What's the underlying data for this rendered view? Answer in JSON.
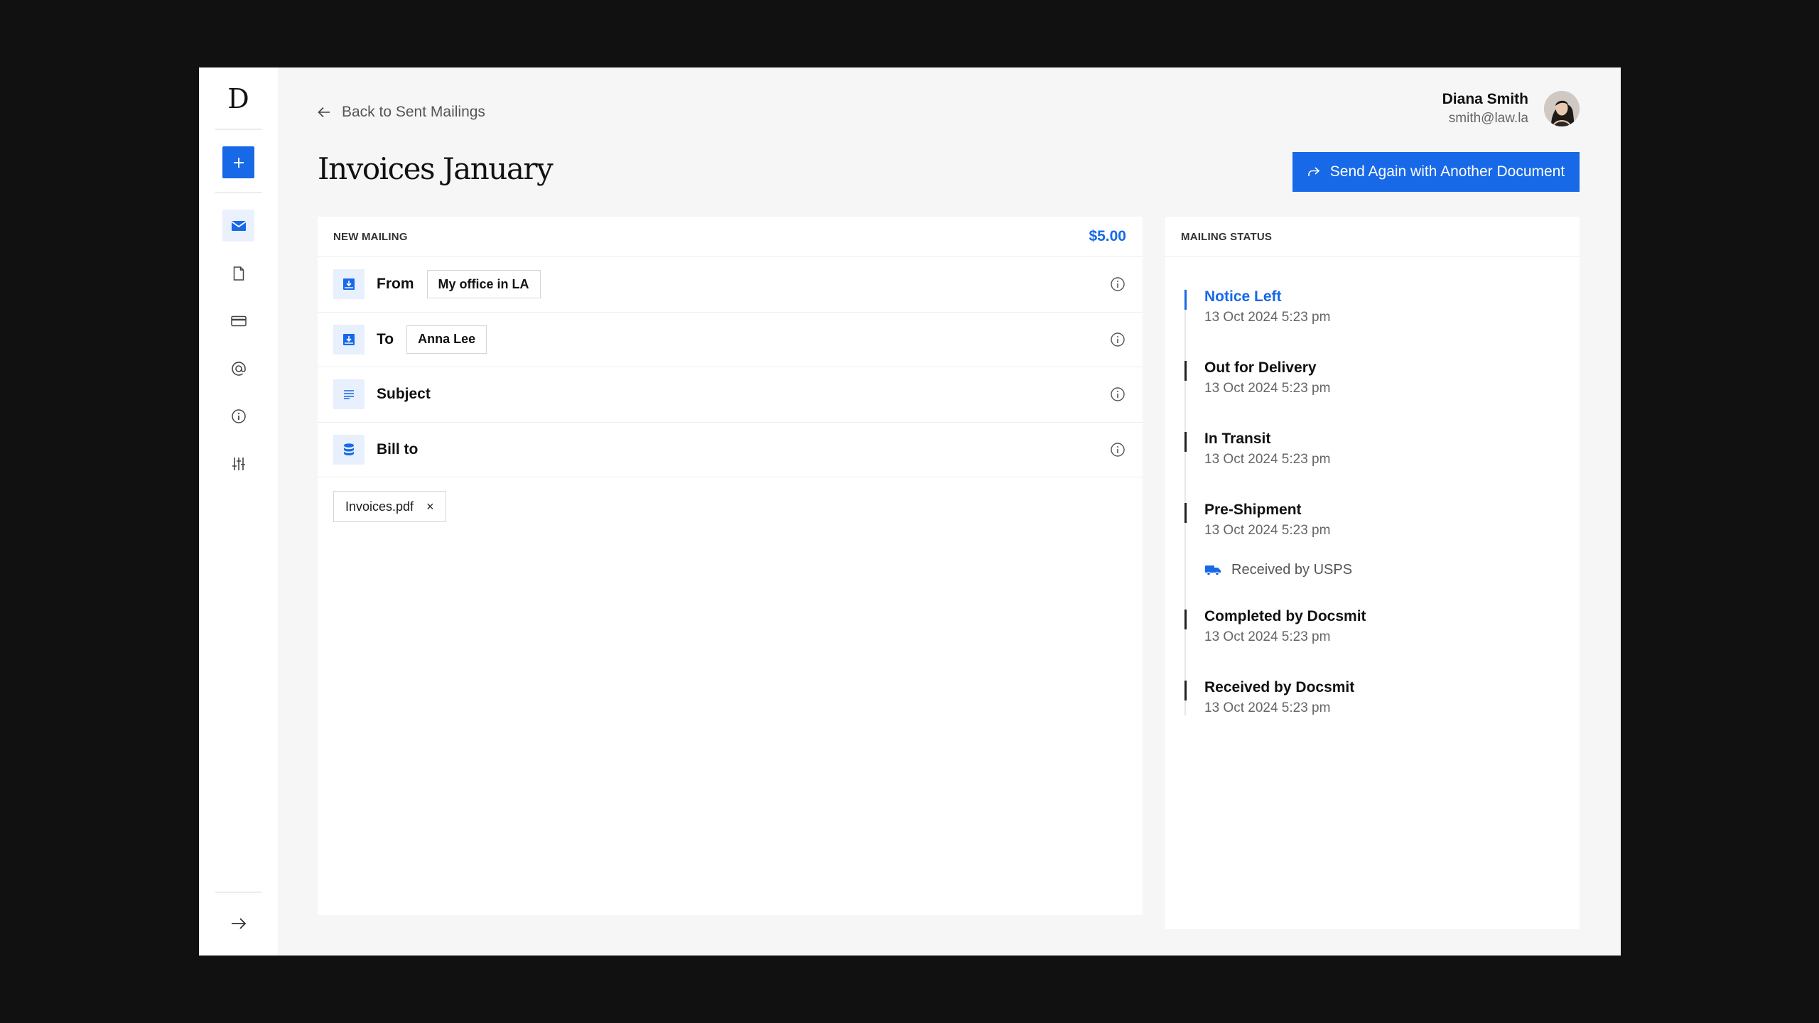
{
  "brand": {
    "logo": "D"
  },
  "sidebar": {
    "items": [
      {
        "icon": "mail-icon"
      },
      {
        "icon": "document-icon"
      },
      {
        "icon": "credit-card-icon"
      },
      {
        "icon": "at-sign-icon"
      },
      {
        "icon": "info-icon"
      },
      {
        "icon": "sliders-icon"
      }
    ],
    "add_icon": "plus-icon",
    "collapse_icon": "arrow-right-icon"
  },
  "header": {
    "back_label": "Back to Sent Mailings",
    "user_name": "Diana Smith",
    "user_email": "smith@law.la"
  },
  "page": {
    "title": "Invoices January",
    "primary_action": "Send Again with Another Document"
  },
  "mailing": {
    "section_label": "NEW MAILING",
    "price": "$5.00",
    "from_label": "From",
    "from_value": "My office in LA",
    "to_label": "To",
    "to_value": "Anna Lee",
    "subject_label": "Subject",
    "bill_to_label": "Bill to",
    "attachment": "Invoices.pdf",
    "remove_glyph": "×"
  },
  "status": {
    "section_label": "MAILING STATUS",
    "events": [
      {
        "title": "Notice Left",
        "date": "13 Oct 2024 5:23 pm",
        "active": true
      },
      {
        "title": "Out for Delivery",
        "date": "13 Oct 2024 5:23 pm"
      },
      {
        "title": "In Transit",
        "date": "13 Oct 2024 5:23 pm"
      },
      {
        "title": "Pre-Shipment",
        "date": "13 Oct 2024 5:23 pm"
      },
      {
        "title": "Completed by Docsmit",
        "date": "13 Oct 2024 5:23 pm"
      },
      {
        "title": "Received by Docsmit",
        "date": "13 Oct 2024 5:23 pm"
      }
    ],
    "usps_note": "Received by USPS"
  },
  "colors": {
    "accent": "#1769e8",
    "background": "#f6f6f6",
    "frame": "#111111"
  }
}
